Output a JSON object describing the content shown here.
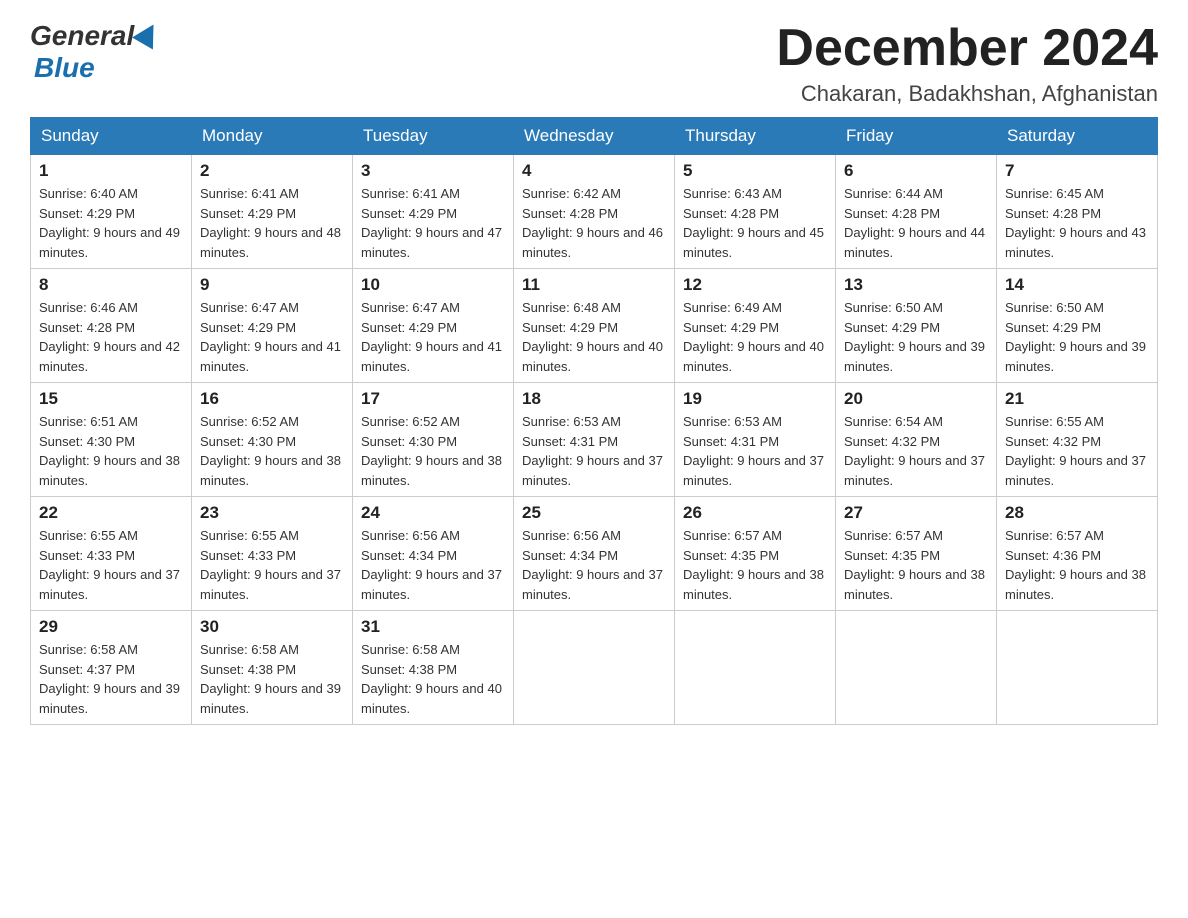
{
  "header": {
    "logo_general": "General",
    "logo_blue": "Blue",
    "month_title": "December 2024",
    "location": "Chakaran, Badakhshan, Afghanistan"
  },
  "days_of_week": [
    "Sunday",
    "Monday",
    "Tuesday",
    "Wednesday",
    "Thursday",
    "Friday",
    "Saturday"
  ],
  "weeks": [
    [
      {
        "num": "1",
        "sunrise": "6:40 AM",
        "sunset": "4:29 PM",
        "daylight": "9 hours and 49 minutes."
      },
      {
        "num": "2",
        "sunrise": "6:41 AM",
        "sunset": "4:29 PM",
        "daylight": "9 hours and 48 minutes."
      },
      {
        "num": "3",
        "sunrise": "6:41 AM",
        "sunset": "4:29 PM",
        "daylight": "9 hours and 47 minutes."
      },
      {
        "num": "4",
        "sunrise": "6:42 AM",
        "sunset": "4:28 PM",
        "daylight": "9 hours and 46 minutes."
      },
      {
        "num": "5",
        "sunrise": "6:43 AM",
        "sunset": "4:28 PM",
        "daylight": "9 hours and 45 minutes."
      },
      {
        "num": "6",
        "sunrise": "6:44 AM",
        "sunset": "4:28 PM",
        "daylight": "9 hours and 44 minutes."
      },
      {
        "num": "7",
        "sunrise": "6:45 AM",
        "sunset": "4:28 PM",
        "daylight": "9 hours and 43 minutes."
      }
    ],
    [
      {
        "num": "8",
        "sunrise": "6:46 AM",
        "sunset": "4:28 PM",
        "daylight": "9 hours and 42 minutes."
      },
      {
        "num": "9",
        "sunrise": "6:47 AM",
        "sunset": "4:29 PM",
        "daylight": "9 hours and 41 minutes."
      },
      {
        "num": "10",
        "sunrise": "6:47 AM",
        "sunset": "4:29 PM",
        "daylight": "9 hours and 41 minutes."
      },
      {
        "num": "11",
        "sunrise": "6:48 AM",
        "sunset": "4:29 PM",
        "daylight": "9 hours and 40 minutes."
      },
      {
        "num": "12",
        "sunrise": "6:49 AM",
        "sunset": "4:29 PM",
        "daylight": "9 hours and 40 minutes."
      },
      {
        "num": "13",
        "sunrise": "6:50 AM",
        "sunset": "4:29 PM",
        "daylight": "9 hours and 39 minutes."
      },
      {
        "num": "14",
        "sunrise": "6:50 AM",
        "sunset": "4:29 PM",
        "daylight": "9 hours and 39 minutes."
      }
    ],
    [
      {
        "num": "15",
        "sunrise": "6:51 AM",
        "sunset": "4:30 PM",
        "daylight": "9 hours and 38 minutes."
      },
      {
        "num": "16",
        "sunrise": "6:52 AM",
        "sunset": "4:30 PM",
        "daylight": "9 hours and 38 minutes."
      },
      {
        "num": "17",
        "sunrise": "6:52 AM",
        "sunset": "4:30 PM",
        "daylight": "9 hours and 38 minutes."
      },
      {
        "num": "18",
        "sunrise": "6:53 AM",
        "sunset": "4:31 PM",
        "daylight": "9 hours and 37 minutes."
      },
      {
        "num": "19",
        "sunrise": "6:53 AM",
        "sunset": "4:31 PM",
        "daylight": "9 hours and 37 minutes."
      },
      {
        "num": "20",
        "sunrise": "6:54 AM",
        "sunset": "4:32 PM",
        "daylight": "9 hours and 37 minutes."
      },
      {
        "num": "21",
        "sunrise": "6:55 AM",
        "sunset": "4:32 PM",
        "daylight": "9 hours and 37 minutes."
      }
    ],
    [
      {
        "num": "22",
        "sunrise": "6:55 AM",
        "sunset": "4:33 PM",
        "daylight": "9 hours and 37 minutes."
      },
      {
        "num": "23",
        "sunrise": "6:55 AM",
        "sunset": "4:33 PM",
        "daylight": "9 hours and 37 minutes."
      },
      {
        "num": "24",
        "sunrise": "6:56 AM",
        "sunset": "4:34 PM",
        "daylight": "9 hours and 37 minutes."
      },
      {
        "num": "25",
        "sunrise": "6:56 AM",
        "sunset": "4:34 PM",
        "daylight": "9 hours and 37 minutes."
      },
      {
        "num": "26",
        "sunrise": "6:57 AM",
        "sunset": "4:35 PM",
        "daylight": "9 hours and 38 minutes."
      },
      {
        "num": "27",
        "sunrise": "6:57 AM",
        "sunset": "4:35 PM",
        "daylight": "9 hours and 38 minutes."
      },
      {
        "num": "28",
        "sunrise": "6:57 AM",
        "sunset": "4:36 PM",
        "daylight": "9 hours and 38 minutes."
      }
    ],
    [
      {
        "num": "29",
        "sunrise": "6:58 AM",
        "sunset": "4:37 PM",
        "daylight": "9 hours and 39 minutes."
      },
      {
        "num": "30",
        "sunrise": "6:58 AM",
        "sunset": "4:38 PM",
        "daylight": "9 hours and 39 minutes."
      },
      {
        "num": "31",
        "sunrise": "6:58 AM",
        "sunset": "4:38 PM",
        "daylight": "9 hours and 40 minutes."
      },
      null,
      null,
      null,
      null
    ]
  ]
}
